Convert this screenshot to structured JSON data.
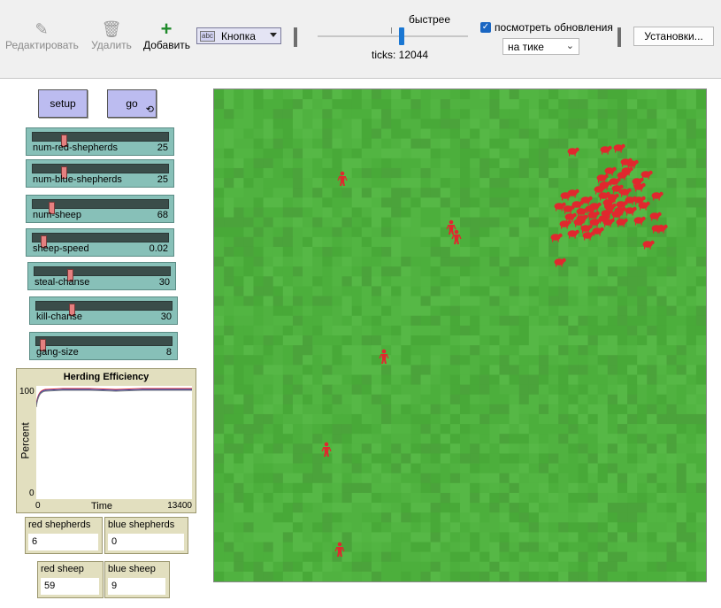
{
  "toolbar": {
    "edit_label": "Редактировать",
    "delete_label": "Удалить",
    "add_label": "Добавить",
    "widget_type": "Кнопка",
    "widget_icon_text": "abc",
    "speed_label": "быстрее",
    "ticks_label": "ticks: 12044",
    "view_updates_label": "посмотреть обновления",
    "update_mode": "на тике",
    "settings_label": "Установки..."
  },
  "icons": {
    "edit": "pencil-icon",
    "delete": "trash-icon",
    "add": "plus-icon",
    "forever": "forever-loop-icon"
  },
  "buttons": {
    "setup": "setup",
    "go": "go"
  },
  "sliders": [
    {
      "name": "num-red-shepherds",
      "value": "25",
      "fraction": 0.22
    },
    {
      "name": "num-blue-shepherds",
      "value": "25",
      "fraction": 0.22
    },
    {
      "name": "num-sheep",
      "value": "68",
      "fraction": 0.12
    },
    {
      "name": "sheep-speed",
      "value": "0.02",
      "fraction": 0.06
    },
    {
      "name": "steal-chanse",
      "value": "30",
      "fraction": 0.25
    },
    {
      "name": "kill-chanse",
      "value": "30",
      "fraction": 0.25
    },
    {
      "name": "gang-size",
      "value": "8",
      "fraction": 0.03
    }
  ],
  "plot": {
    "title": "Herding Efficiency",
    "ylabel": "Percent",
    "xlabel": "Time",
    "ymax": "100",
    "ymin": "0",
    "xmin": "0",
    "xmax": "13400"
  },
  "monitors": {
    "red_shepherds": {
      "label": "red shepherds",
      "value": "6"
    },
    "blue_shepherds": {
      "label": "blue shepherds",
      "value": "0"
    },
    "red_sheep": {
      "label": "red sheep",
      "value": "59"
    },
    "blue_sheep": {
      "label": "blue sheep",
      "value": "9"
    }
  },
  "colors": {
    "grass": "#4caf3c",
    "agent_red": "#e0282e",
    "button": "#bcbcf0",
    "slider": "#87c0b8",
    "monitor": "#e2dfbf"
  }
}
